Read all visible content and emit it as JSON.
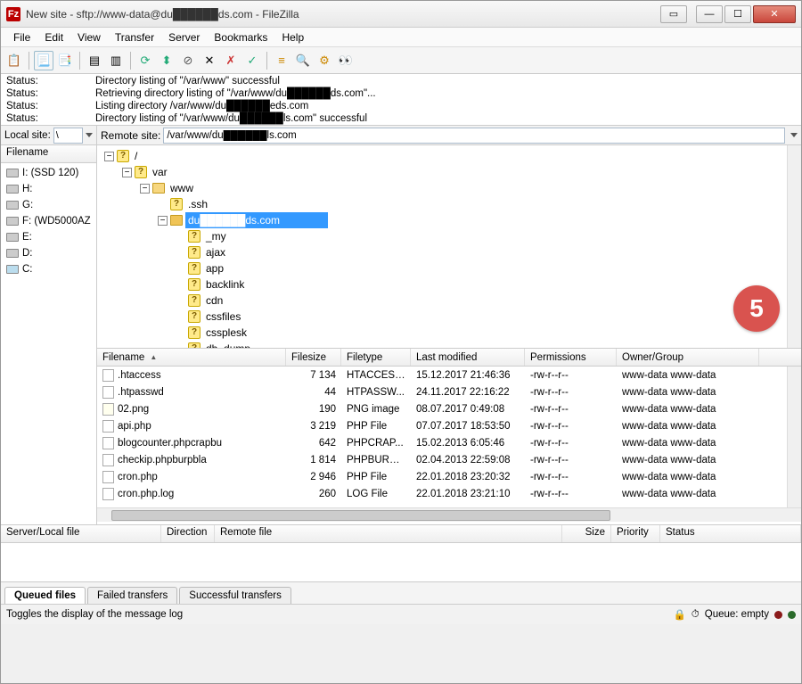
{
  "window": {
    "title": "New site - sftp://www-data@du██████ds.com - FileZilla"
  },
  "menu": [
    "File",
    "Edit",
    "View",
    "Transfer",
    "Server",
    "Bookmarks",
    "Help"
  ],
  "log": {
    "label": "Status:",
    "lines": [
      "Directory listing of \"/var/www\" successful",
      "Retrieving directory listing of \"/var/www/du██████ds.com\"...",
      "Listing directory /var/www/du██████eds.com",
      "Directory listing of \"/var/www/du██████ls.com\" successful"
    ]
  },
  "local": {
    "site_label": "Local site:",
    "path": "\\",
    "col": "Filename",
    "drives": [
      "I: (SSD 120)",
      "H:",
      "G:",
      "F: (WD5000AZ",
      "E:",
      "D:",
      "C:"
    ]
  },
  "remote": {
    "site_label": "Remote site:",
    "path": "/var/www/du██████ls.com",
    "tree": {
      "root": "/",
      "var": "var",
      "www": "www",
      "ssh": ".ssh",
      "selected": "du██████ds.com",
      "children": [
        "_my",
        "ajax",
        "app",
        "backlink",
        "cdn",
        "cssfiles",
        "cssplesk",
        "db_dump"
      ]
    }
  },
  "filelist": {
    "headers": {
      "name": "Filename",
      "size": "Filesize",
      "type": "Filetype",
      "mod": "Last modified",
      "perm": "Permissions",
      "own": "Owner/Group"
    },
    "rows": [
      {
        "name": ".htaccess",
        "size": "7 134",
        "type": "HTACCESS...",
        "mod": "15.12.2017 21:46:36",
        "perm": "-rw-r--r--",
        "own": "www-data www-data"
      },
      {
        "name": ".htpasswd",
        "size": "44",
        "type": "HTPASSW...",
        "mod": "24.11.2017 22:16:22",
        "perm": "-rw-r--r--",
        "own": "www-data www-data"
      },
      {
        "name": "02.png",
        "size": "190",
        "type": "PNG image",
        "mod": "08.07.2017 0:49:08",
        "perm": "-rw-r--r--",
        "own": "www-data www-data"
      },
      {
        "name": "api.php",
        "size": "3 219",
        "type": "PHP File",
        "mod": "07.07.2017 18:53:50",
        "perm": "-rw-r--r--",
        "own": "www-data www-data"
      },
      {
        "name": "blogcounter.phpcrapbu",
        "size": "642",
        "type": "PHPCRAP...",
        "mod": "15.02.2013 6:05:46",
        "perm": "-rw-r--r--",
        "own": "www-data www-data"
      },
      {
        "name": "checkip.phpburpbla",
        "size": "1 814",
        "type": "PHPBURPB...",
        "mod": "02.04.2013 22:59:08",
        "perm": "-rw-r--r--",
        "own": "www-data www-data"
      },
      {
        "name": "cron.php",
        "size": "2 946",
        "type": "PHP File",
        "mod": "22.01.2018 23:20:32",
        "perm": "-rw-r--r--",
        "own": "www-data www-data"
      },
      {
        "name": "cron.php.log",
        "size": "260",
        "type": "LOG File",
        "mod": "22.01.2018 23:21:10",
        "perm": "-rw-r--r--",
        "own": "www-data www-data"
      }
    ]
  },
  "queue": {
    "headers": {
      "a": "Server/Local file",
      "b": "Direction",
      "c": "Remote file",
      "d": "Size",
      "e": "Priority",
      "f": "Status"
    }
  },
  "tabs": {
    "queued": "Queued files",
    "failed": "Failed transfers",
    "success": "Successful transfers"
  },
  "statusbar": {
    "text": "Toggles the display of the message log",
    "queue": "Queue: empty"
  },
  "badge": "5"
}
